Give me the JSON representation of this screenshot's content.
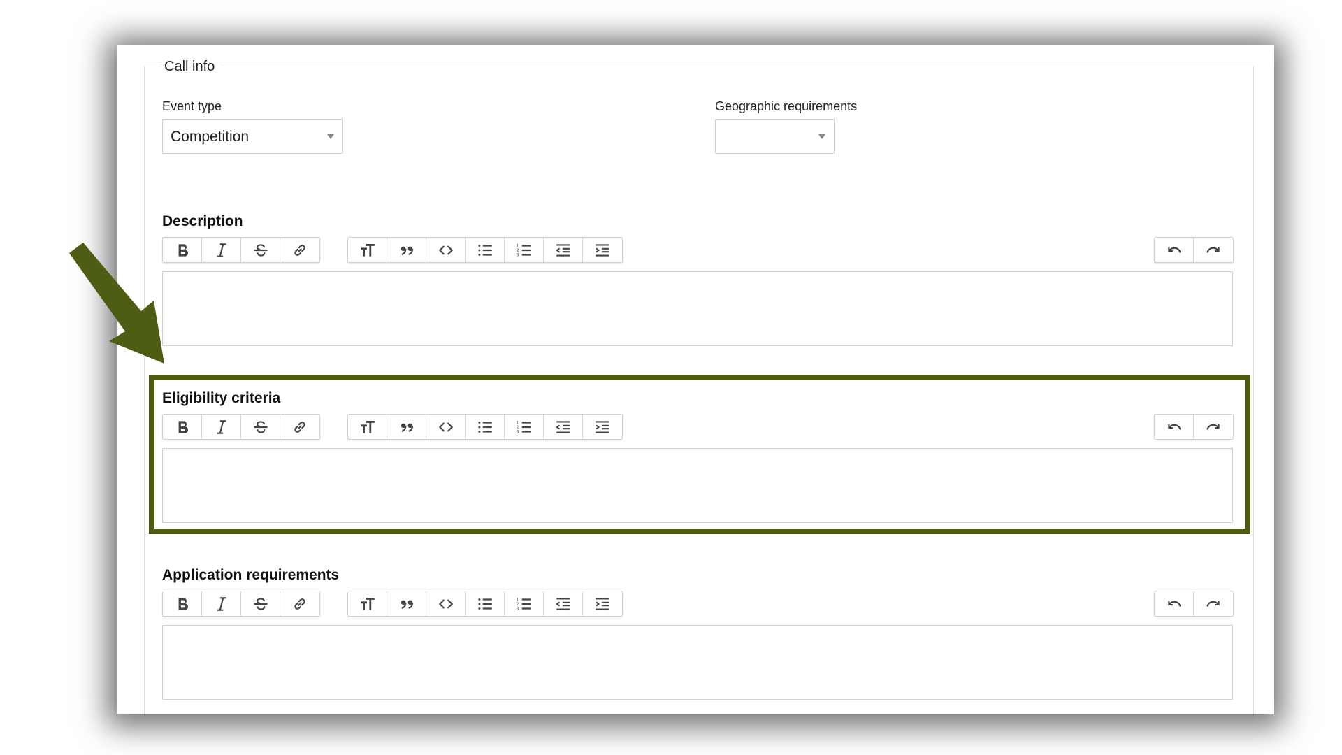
{
  "fieldset": {
    "legend": "Call info"
  },
  "event_type": {
    "label": "Event type",
    "value": "Competition"
  },
  "geographic": {
    "label": "Geographic requirements",
    "value": ""
  },
  "sections": [
    {
      "title": "Description"
    },
    {
      "title": "Eligibility criteria"
    },
    {
      "title": "Application requirements"
    }
  ],
  "toolbar": {
    "format_group": [
      "bold-icon",
      "italic-icon",
      "strikethrough-icon",
      "link-icon"
    ],
    "block_group": [
      "heading-icon",
      "quote-icon",
      "code-icon",
      "bullet-list-icon",
      "numbered-list-icon",
      "outdent-icon",
      "indent-icon"
    ],
    "history_group": [
      "undo-icon",
      "redo-icon"
    ]
  },
  "annotation": {
    "color": "#4d5e14"
  }
}
